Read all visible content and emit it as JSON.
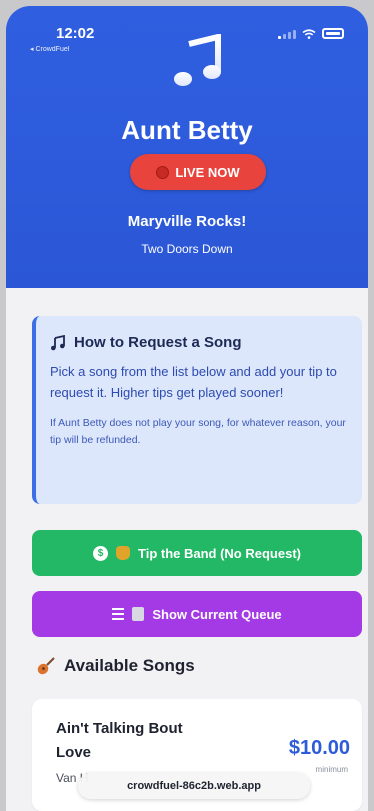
{
  "status_bar": {
    "time": "12:02",
    "back_app": "◂ CrowdFuel"
  },
  "hero": {
    "artist": "Aunt Betty",
    "live_label": "LIVE NOW",
    "venue": "Maryville Rocks!",
    "subvenue": "Two Doors Down"
  },
  "info_card": {
    "title": "How to Request a Song",
    "body": "Pick a song from the list below and add your tip to request it. Higher tips get played sooner!",
    "note": "If Aunt Betty does not play your song, for whatever reason, your tip will be refunded."
  },
  "actions": {
    "tip_label": "Tip the Band (No Request)",
    "queue_label": "Show Current Queue"
  },
  "songs_section": {
    "title": "Available Songs"
  },
  "songs": [
    {
      "title": "Ain't Talking Bout Love",
      "artist": "Van H",
      "price": "$10.00",
      "min_label": "minimum"
    }
  ],
  "browser": {
    "url": "crowdfuel-86c2b.web.app"
  },
  "colors": {
    "hero": "#2b57d6",
    "live": "#e8443d",
    "tip": "#22b865",
    "queue": "#a33ae6",
    "price": "#2d5bd9"
  }
}
